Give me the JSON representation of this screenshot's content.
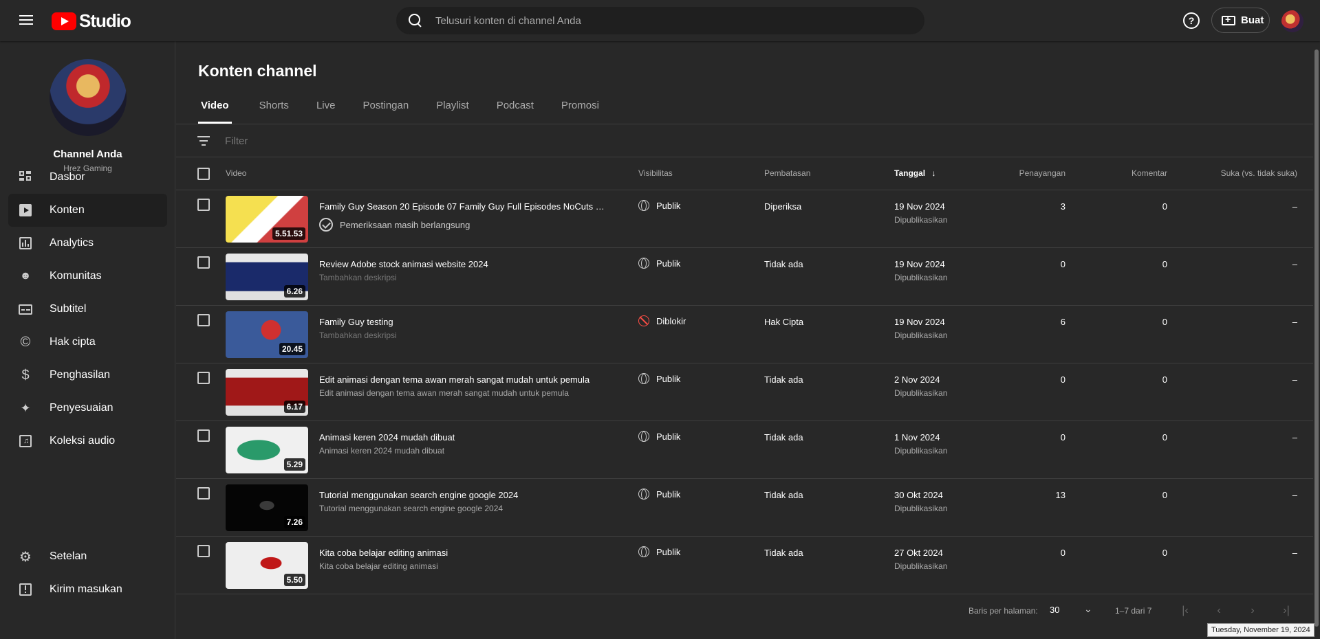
{
  "header": {
    "logo_text": "Studio",
    "search_placeholder": "Telusuri konten di channel Anda",
    "help_glyph": "?",
    "create_label": "Buat"
  },
  "sidebar": {
    "channel_name": "Channel Anda",
    "channel_handle": "Hrez Gaming",
    "items": [
      {
        "label": "Dasbor",
        "icon": "dashboard-icon"
      },
      {
        "label": "Konten",
        "icon": "content-icon"
      },
      {
        "label": "Analytics",
        "icon": "analytics-icon"
      },
      {
        "label": "Komunitas",
        "icon": "community-icon"
      },
      {
        "label": "Subtitel",
        "icon": "subtitles-icon"
      },
      {
        "label": "Hak cipta",
        "icon": "copyright-icon"
      },
      {
        "label": "Penghasilan",
        "icon": "dollar-icon"
      },
      {
        "label": "Penyesuaian",
        "icon": "magic-wand-icon"
      },
      {
        "label": "Koleksi audio",
        "icon": "audio-library-icon"
      }
    ],
    "bottom_items": [
      {
        "label": "Setelan",
        "icon": "gear-icon"
      },
      {
        "label": "Kirim masukan",
        "icon": "feedback-icon"
      }
    ],
    "active_item": "Konten"
  },
  "main": {
    "title": "Konten channel",
    "tabs": [
      "Video",
      "Shorts",
      "Live",
      "Postingan",
      "Playlist",
      "Podcast",
      "Promosi"
    ],
    "active_tab": "Video",
    "filter_placeholder": "Filter",
    "columns": {
      "video": "Video",
      "visibility": "Visibilitas",
      "restrictions": "Pembatasan",
      "date": "Tanggal",
      "views": "Penayangan",
      "comments": "Komentar",
      "likes": "Suka (vs. tidak suka)"
    },
    "rows": [
      {
        "title": "Family Guy Season 20 Episode 07 Family Guy Full Episodes NoCuts No...",
        "desc": "Pemeriksaan masih berlangsung",
        "duration": "5.51.53",
        "visibility": "Publik",
        "restriction": "Diperiksa",
        "date": "19 Nov 2024",
        "status": "Dipublikasikan",
        "views": "3",
        "comments": "0",
        "likes": "–"
      },
      {
        "title": "Review Adobe stock animasi website 2024",
        "desc": "Tambahkan deskripsi",
        "duration": "6.26",
        "visibility": "Publik",
        "restriction": "Tidak ada",
        "date": "19 Nov 2024",
        "status": "Dipublikasikan",
        "views": "0",
        "comments": "0",
        "likes": "–"
      },
      {
        "title": "Family Guy testing",
        "desc": "Tambahkan deskripsi",
        "duration": "20.45",
        "visibility": "Diblokir",
        "restriction": "Hak Cipta",
        "date": "19 Nov 2024",
        "status": "Dipublikasikan",
        "views": "6",
        "comments": "0",
        "likes": "–"
      },
      {
        "title": "Edit animasi dengan tema awan merah sangat mudah untuk pemula",
        "desc": "Edit animasi dengan tema awan merah sangat mudah untuk pemula",
        "duration": "6.17",
        "visibility": "Publik",
        "restriction": "Tidak ada",
        "date": "2 Nov 2024",
        "status": "Dipublikasikan",
        "views": "0",
        "comments": "0",
        "likes": "–"
      },
      {
        "title": "Animasi keren 2024 mudah dibuat",
        "desc": "Animasi keren 2024 mudah dibuat",
        "duration": "5.29",
        "visibility": "Publik",
        "restriction": "Tidak ada",
        "date": "1 Nov 2024",
        "status": "Dipublikasikan",
        "views": "0",
        "comments": "0",
        "likes": "–"
      },
      {
        "title": "Tutorial menggunakan search engine google 2024",
        "desc": "Tutorial menggunakan search engine google 2024",
        "duration": "7.26",
        "visibility": "Publik",
        "restriction": "Tidak ada",
        "date": "30 Okt 2024",
        "status": "Dipublikasikan",
        "views": "13",
        "comments": "0",
        "likes": "–"
      },
      {
        "title": "Kita coba belajar editing animasi",
        "desc": "Kita coba belajar editing animasi",
        "duration": "5.50",
        "visibility": "Publik",
        "restriction": "Tidak ada",
        "date": "27 Okt 2024",
        "status": "Dipublikasikan",
        "views": "0",
        "comments": "0",
        "likes": "–"
      }
    ],
    "pagination": {
      "rows_per_page_label": "Baris per halaman:",
      "rows_per_page": "30",
      "range": "1–7 dari 7"
    }
  },
  "tooltip": "Tuesday, November 19, 2024",
  "colors": {
    "bg": "#282828",
    "brand": "#ff0000",
    "blocked": "#ff4e45"
  }
}
